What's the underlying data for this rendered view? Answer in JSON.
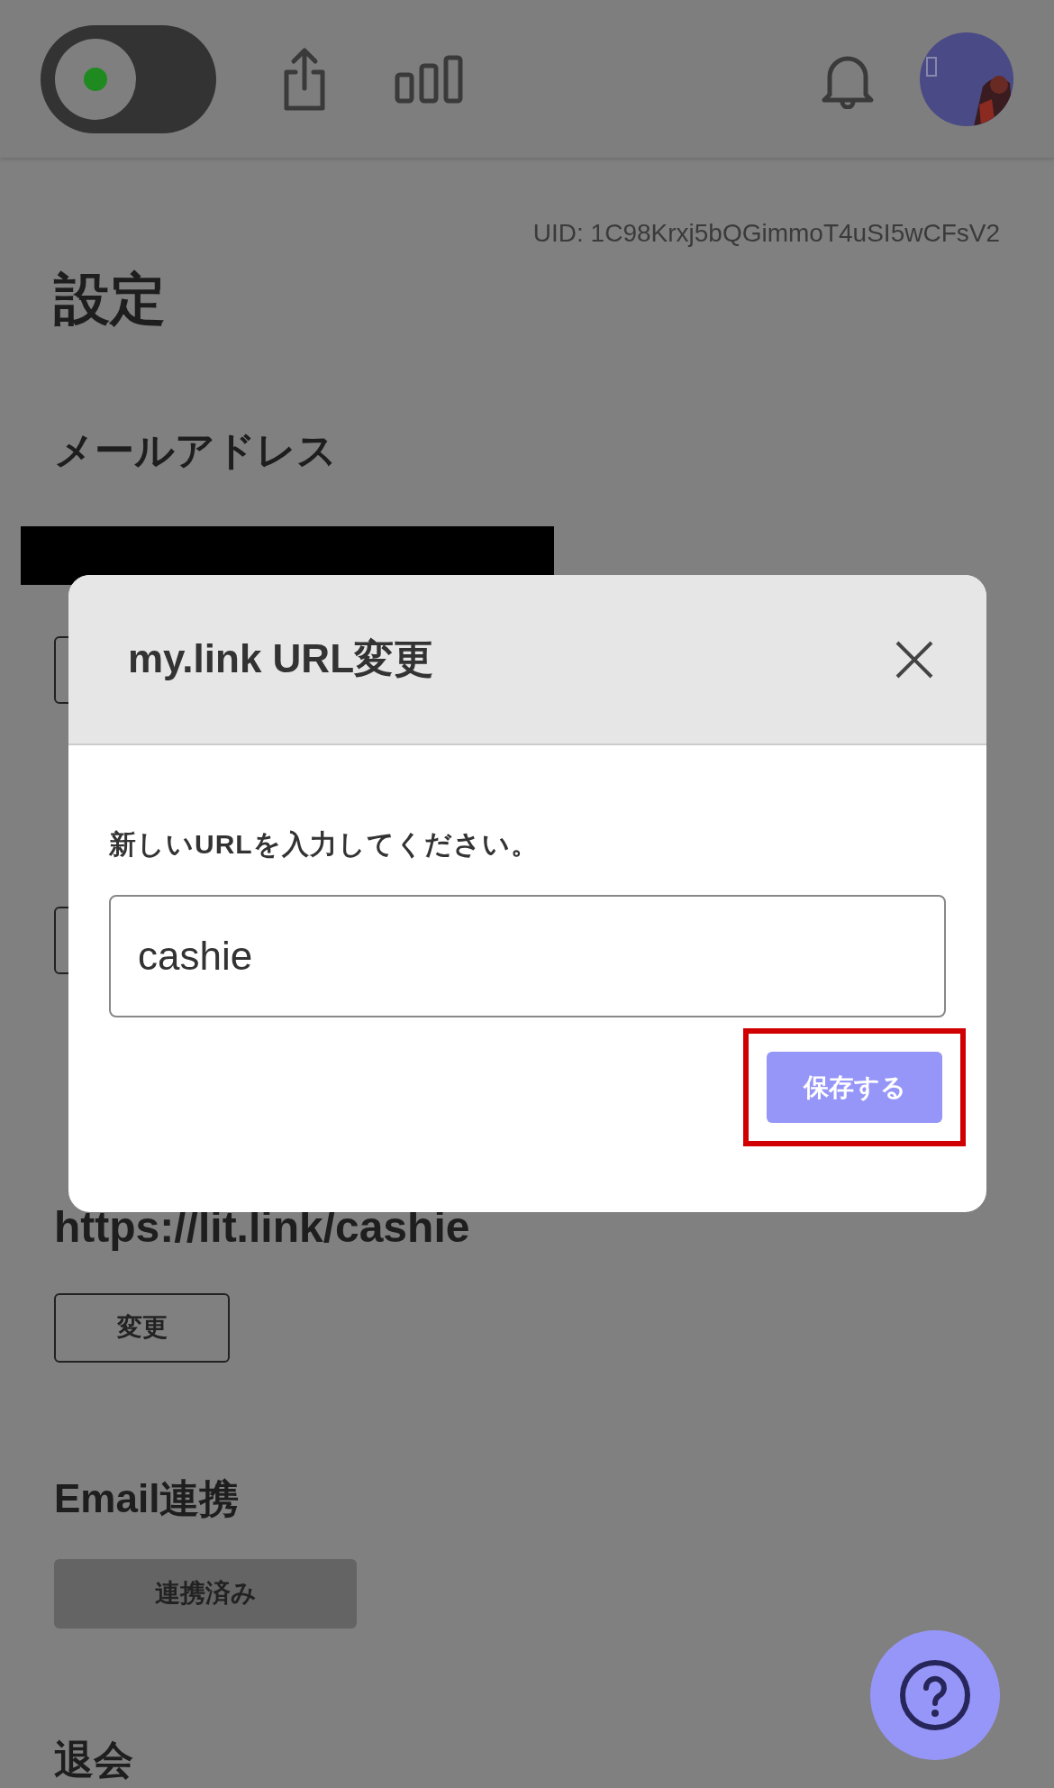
{
  "header": {
    "toggle": {
      "on": true
    }
  },
  "settings": {
    "uid": "UID: 1C98Krxj5bQGimmoT4uSI5wCFsV2",
    "title": "設定",
    "email_label": "メールアドレス",
    "url_value": "https://lit.link/cashie",
    "change_button": "変更",
    "email_link_heading": "Email連携",
    "email_link_button": "連携済み",
    "withdraw_heading": "退会"
  },
  "modal": {
    "title": "my.link URL変更",
    "prompt": "新しいURLを入力してください。",
    "input_value": "cashie",
    "save_button": "保存する",
    "save_highlighted": true
  }
}
